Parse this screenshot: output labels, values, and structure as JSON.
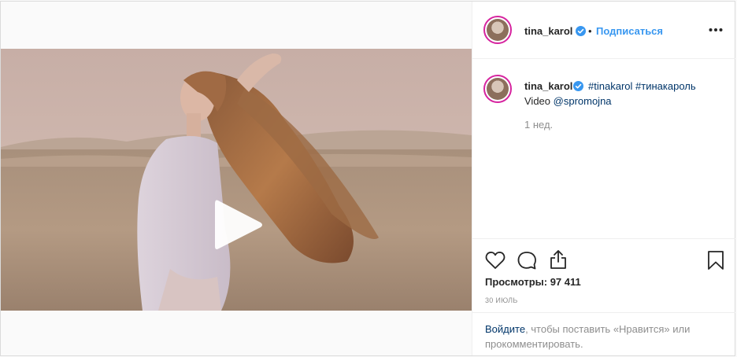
{
  "post": {
    "username": "tina_karol",
    "verified": true,
    "dot": "•",
    "follow_label": "Подписаться",
    "more_icon": "more-horizontal-icon",
    "caption": {
      "username": "tina_karol",
      "hashtag1": "#tinakarol",
      "hashtag2": "#тинакароль",
      "line2_prefix": "Video",
      "mention": "@spromojna"
    },
    "time_ago": "1 нед.",
    "views_label": "Просмотры: 97 411",
    "date": "30 ИЮЛЬ",
    "login_link": "Войдите",
    "login_rest": ", чтобы поставить «Нравится» или прокомментировать.",
    "icons": [
      "heart-icon",
      "comment-icon",
      "share-icon",
      "bookmark-icon",
      "play-icon",
      "verified-badge-icon"
    ],
    "colors": {
      "link_blue": "#3897f0",
      "verified_blue": "#3897f0",
      "hashtag": "#003569",
      "muted": "#8e8e8e",
      "border": "#dbdbdb"
    }
  }
}
